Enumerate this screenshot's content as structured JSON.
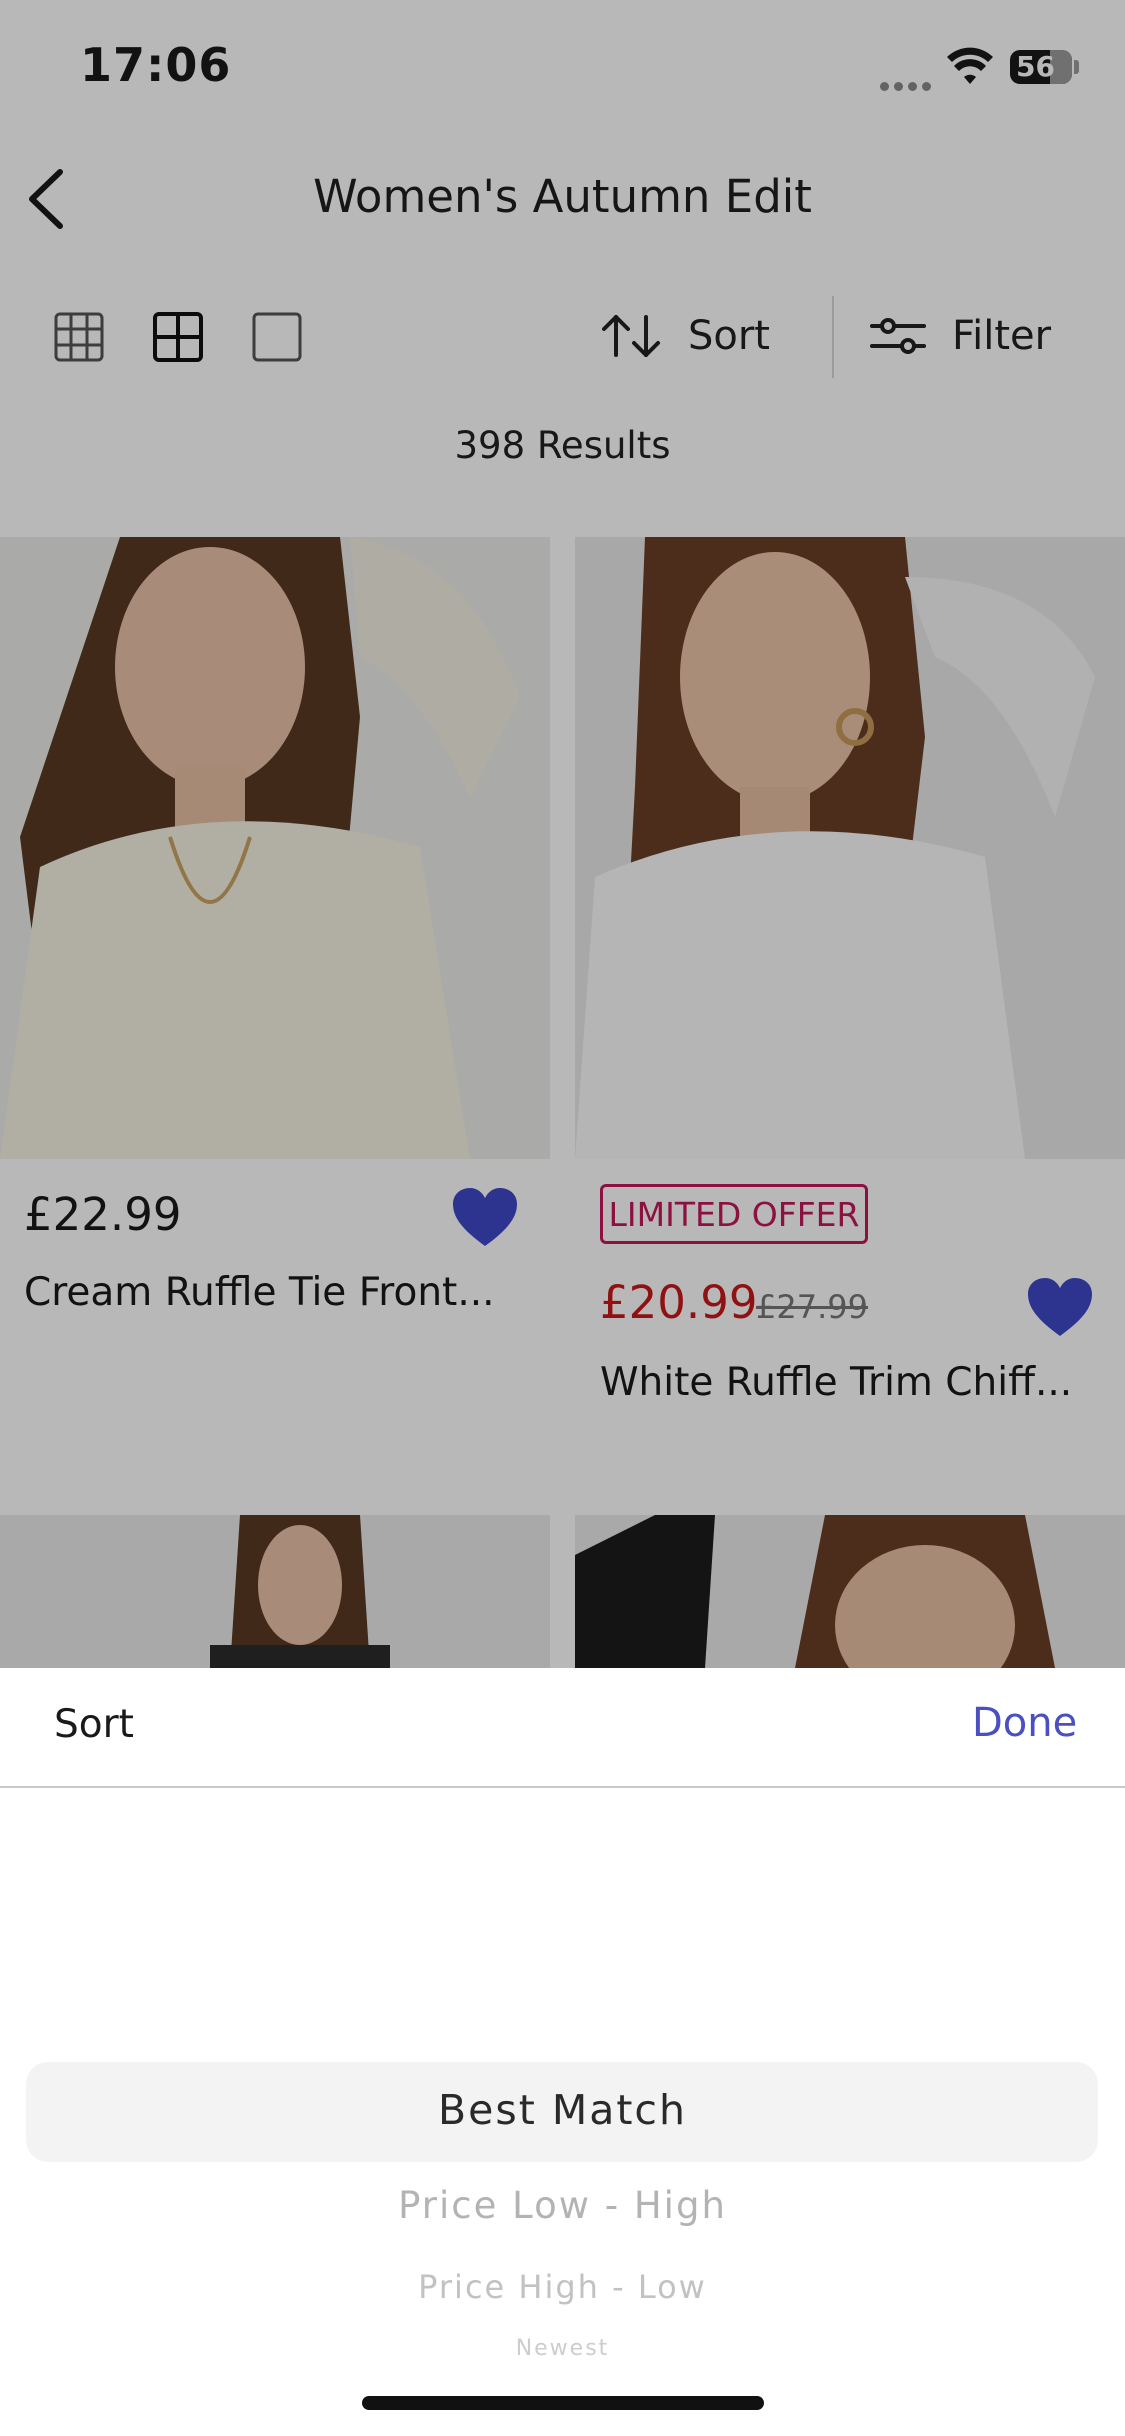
{
  "status_bar": {
    "time": "17:06",
    "battery": "56"
  },
  "header": {
    "title": "Women's Autumn Edit"
  },
  "toolbar": {
    "view_options": [
      "grid-3x3-icon",
      "grid-2x2-icon",
      "single-view-icon"
    ],
    "sort_label": "Sort",
    "filter_label": "Filter"
  },
  "results": {
    "count_text": "398 Results"
  },
  "products": [
    {
      "price": "£22.99",
      "name": "Cream Ruffle Tie Front...",
      "favorited": true
    },
    {
      "badge": "LIMITED OFFER",
      "price": "£20.99",
      "was_price": "£27.99",
      "name": "White Ruffle Trim Chiff...",
      "favorited": true
    }
  ],
  "sort_sheet": {
    "title": "Sort",
    "done_label": "Done",
    "options": [
      "Best Match",
      "Price Low - High",
      "Price High - Low",
      "Newest"
    ],
    "selected": "Best Match"
  },
  "colors": {
    "accent": "#4a4fc1",
    "sale_red": "#c81818",
    "badge_pink": "#c2185b",
    "heart_blue": "#3f48c8"
  }
}
